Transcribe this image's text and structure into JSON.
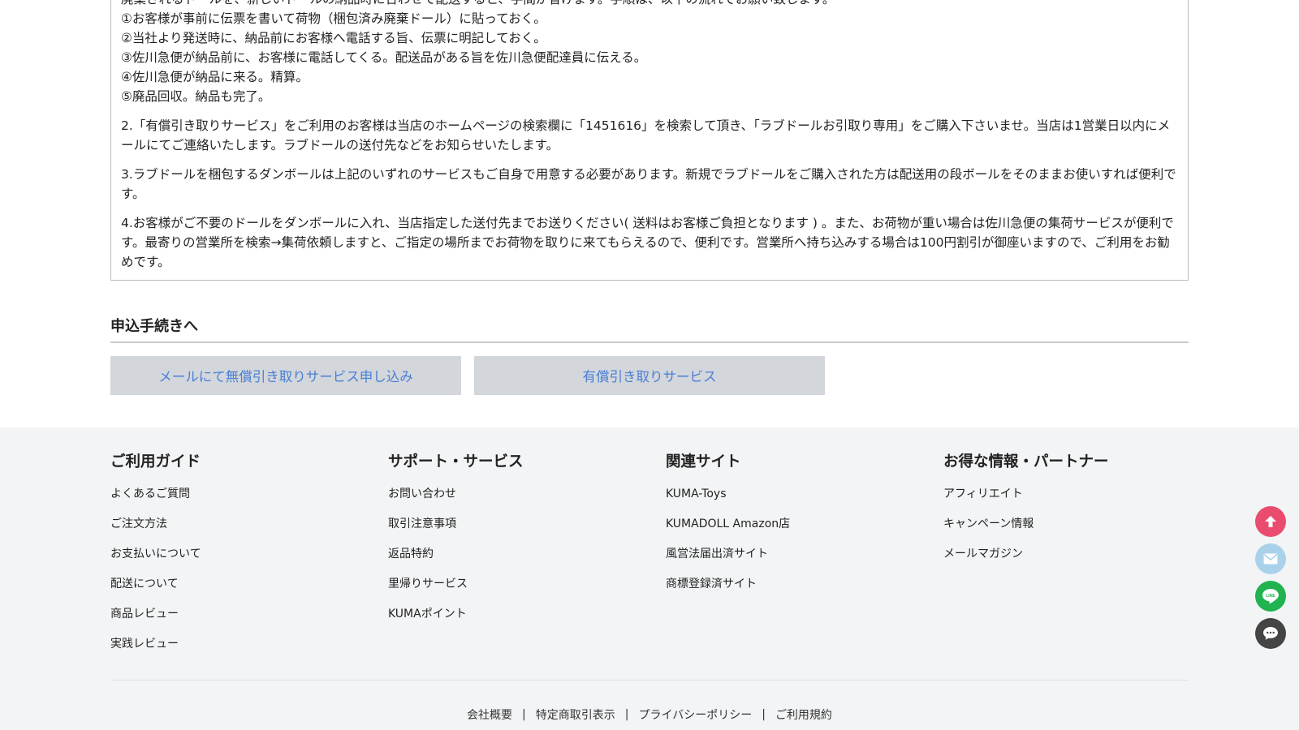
{
  "notice": {
    "top_partial": "廃棄されるドールを、新しいドールの納品時に合わせて配送すると、手間が省けます。手順は、以下の流れでお願い致します。",
    "steps": [
      "①お客様が事前に伝票を書いて荷物（梱包済み廃棄ドール）に貼っておく。",
      "②当社より発送時に、納品前にお客様へ電話する旨、伝票に明記しておく。",
      "③佐川急便が納品前に、お客様に電話してくる。配送品がある旨を佐川急便配達員に伝える。",
      "④佐川急便が納品に来る。精算。",
      "⑤廃品回収。納品も完了。"
    ],
    "para2": "2.「有償引き取りサービス」をご利用のお客様は当店のホームページの検索欄に「1451616」を検索して頂き、「ラブドールお引取り専用」をご購入下さいませ。当店は1営業日以内にメールにてご連絡いたします。ラブドールの送付先などをお知らせいたします。",
    "para3": "3.ラブドールを梱包するダンボールは上記のいずれのサービスもご自身で用意する必要があります。新規でラブドールをご購入された方は配送用の段ボールをそのままお使いすれば便利です。",
    "para4": "4.お客様がご不要のドールをダンボールに入れ、当店指定した送付先までお送りください( 送料はお客様ご負担となります ) 。また、お荷物が重い場合は佐川急便の集荷サービスが便利です。最寄りの営業所を検索→集荷依頼しますと、ご指定の場所までお荷物を取りに来てもらえるので、便利です。営業所へ持ち込みする場合は100円割引が御座いますので、ご利用をお勧めです。"
  },
  "apply": {
    "title": "申込手続きへ",
    "free_button": "メールにて無償引き取りサービス申し込み",
    "paid_button": "有償引き取りサービス"
  },
  "footer": {
    "guide": {
      "title": "ご利用ガイド",
      "items": [
        "よくあるご質問",
        "ご注文方法",
        "お支払いについて",
        "配送について",
        "商品レビュー",
        "実践レビュー"
      ]
    },
    "support": {
      "title": "サポート・サービス",
      "items": [
        "お問い合わせ",
        "取引注意事項",
        "返品特約",
        "里帰りサービス",
        "KUMAポイント"
      ]
    },
    "related": {
      "title": "関連サイト",
      "items": [
        "KUMA-Toys",
        "KUMADOLL Amazon店",
        "風営法届出済サイト",
        "商標登録済サイト"
      ]
    },
    "deals": {
      "title": "お得な情報・パートナー",
      "items": [
        "アフィリエイト",
        "キャンペーン情報",
        "メールマガジン"
      ]
    },
    "bottom_links": [
      "会社概要",
      "特定商取引表示",
      "プライバシーポリシー",
      "ご利用規約"
    ]
  },
  "floating": {
    "colors": {
      "top": "#ea4c6f",
      "mail": "#a9d2ea",
      "line": "#20b34f",
      "chat": "#444444"
    },
    "icons": [
      "arrow-up-icon",
      "mail-icon",
      "line-icon",
      "chat-icon"
    ]
  }
}
